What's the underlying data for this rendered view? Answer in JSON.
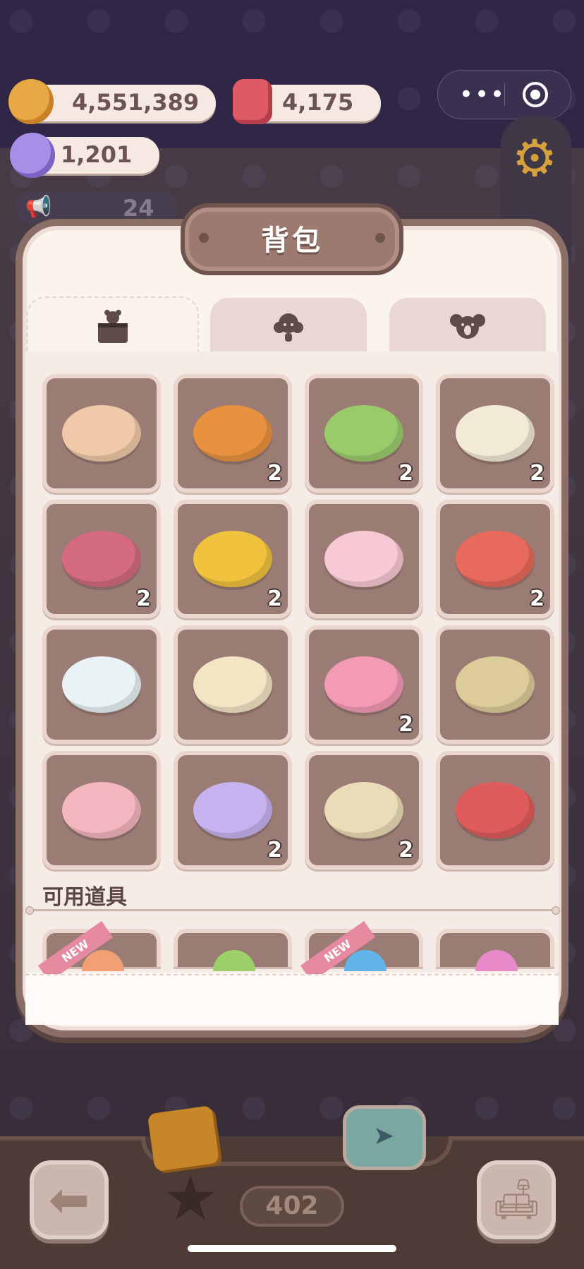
{
  "currencies": {
    "cookies": {
      "value": "4,551,389",
      "icon": "cookie-icon",
      "color": "#e8a844"
    },
    "candles": {
      "value": "4,175",
      "icon": "candle-icon",
      "color": "#e05a66"
    },
    "candy": {
      "value": "1,201",
      "icon": "candy-icon",
      "color": "#a88ee6"
    }
  },
  "announce": {
    "value": "24"
  },
  "panel": {
    "title": "背包"
  },
  "tabs": [
    {
      "icon": "box-bear-icon",
      "active": true
    },
    {
      "icon": "poodle-icon",
      "active": false
    },
    {
      "icon": "koala-icon",
      "active": false
    }
  ],
  "items": [
    {
      "name": "plaid-rug",
      "qty": "",
      "color": "#efc9a8"
    },
    {
      "name": "shiba-plush",
      "qty": "2",
      "color": "#e8913f"
    },
    {
      "name": "leaf-carpet",
      "qty": "2",
      "color": "#9acb6b"
    },
    {
      "name": "cat-cushion",
      "qty": "2",
      "color": "#f3ead6"
    },
    {
      "name": "bead-garland",
      "qty": "2",
      "color": "#d46a7e"
    },
    {
      "name": "lemon-rug",
      "qty": "2",
      "color": "#f1c23d"
    },
    {
      "name": "paw-mat",
      "qty": "",
      "color": "#f7c9d4"
    },
    {
      "name": "watermelon-rug",
      "qty": "2",
      "color": "#e86a5c"
    },
    {
      "name": "calendar-board",
      "qty": "",
      "color": "#eaf2f6"
    },
    {
      "name": "lace-tent",
      "qty": "",
      "color": "#f3e4c4"
    },
    {
      "name": "pink-lamp",
      "qty": "2",
      "color": "#f39ab5"
    },
    {
      "name": "wall-frames",
      "qty": "",
      "color": "#dccc9a"
    },
    {
      "name": "heart-rug",
      "qty": "",
      "color": "#f4b6bf"
    },
    {
      "name": "bunny-rug",
      "qty": "2",
      "color": "#c6b3ef"
    },
    {
      "name": "cream-rug",
      "qty": "2",
      "color": "#eadcb7"
    },
    {
      "name": "rainbow-flag",
      "qty": "",
      "color": "#e05c5c"
    }
  ],
  "usable_items": {
    "title": "可用道具",
    "new_label": "NEW",
    "peek": [
      {
        "new": true,
        "color": "#f0a072"
      },
      {
        "new": false,
        "color": "#9ed06a"
      },
      {
        "new": true,
        "color": "#62b5e8"
      },
      {
        "new": false,
        "color": "#e88ac9"
      }
    ]
  },
  "bottom": {
    "counter": "402"
  }
}
